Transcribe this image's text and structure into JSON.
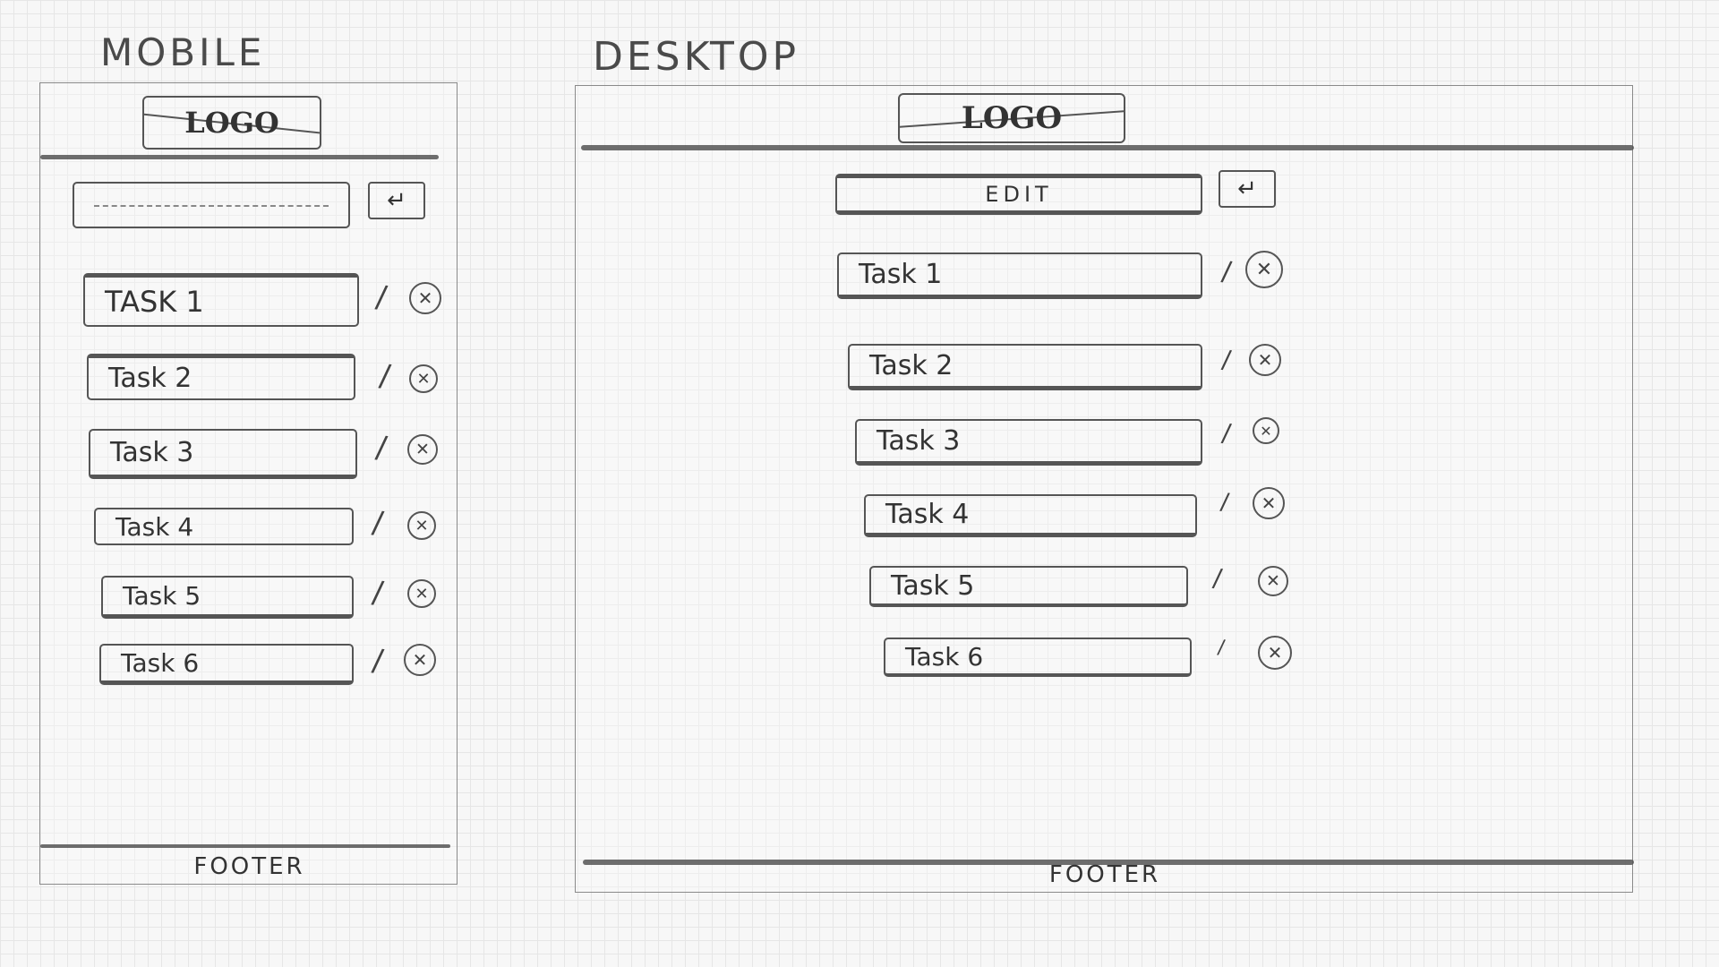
{
  "mobile": {
    "label": "MOBILE",
    "logo": "LOGO",
    "input": {
      "placeholder": "",
      "submit_icon": "↵"
    },
    "tasks": [
      "TASK 1",
      "Task 2",
      "Task 3",
      "Task 4",
      "Task 5",
      "Task 6"
    ],
    "edit_icon": "/",
    "delete_icon": "✕",
    "footer": "FOOTER"
  },
  "desktop": {
    "label": "DESKTOP",
    "logo": "LOGO",
    "input": {
      "value": "EDIT",
      "submit_icon": "↵"
    },
    "tasks": [
      "Task 1",
      "Task 2",
      "Task 3",
      "Task 4",
      "Task 5",
      "Task 6"
    ],
    "edit_icon": "/",
    "delete_icon": "✕",
    "footer": "FOOTER"
  }
}
